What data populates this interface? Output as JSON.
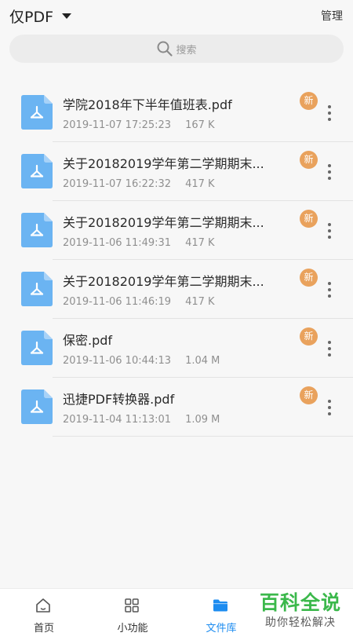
{
  "header": {
    "title": "仅PDF",
    "manage_label": "管理"
  },
  "search": {
    "placeholder": "搜索"
  },
  "colors": {
    "accent": "#1d8cf0",
    "pdf_icon": "#6bb4f2",
    "new_badge": "#e9a25d",
    "watermark": "#3bb84b"
  },
  "files": [
    {
      "name": "学院2018年下半年值班表.pdf",
      "date": "2019-11-07 17:25:23",
      "size": "167 K",
      "badge": "新"
    },
    {
      "name": "关于20182019学年第二学期期末...",
      "date": "2019-11-07 16:22:32",
      "size": "417 K",
      "badge": "新"
    },
    {
      "name": "关于20182019学年第二学期期末...",
      "date": "2019-11-06 11:49:31",
      "size": "417 K",
      "badge": "新"
    },
    {
      "name": "关于20182019学年第二学期期末...",
      "date": "2019-11-06 11:46:19",
      "size": "417 K",
      "badge": "新"
    },
    {
      "name": "保密.pdf",
      "date": "2019-11-06 10:44:13",
      "size": "1.04 M",
      "badge": "新"
    },
    {
      "name": "迅捷PDF转换器.pdf",
      "date": "2019-11-04 11:13:01",
      "size": "1.09 M",
      "badge": "新"
    }
  ],
  "tabs": [
    {
      "label": "首页",
      "icon": "home-icon"
    },
    {
      "label": "小功能",
      "icon": "grid-icon"
    },
    {
      "label": "文件库",
      "icon": "folder-icon",
      "active": true
    }
  ],
  "watermark": {
    "title": "百科全说",
    "subtitle": "助你轻松解决"
  }
}
